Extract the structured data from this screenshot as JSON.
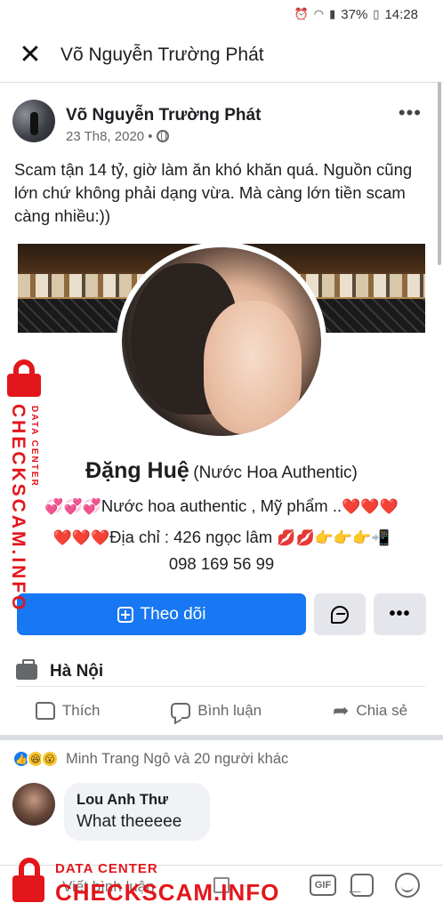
{
  "status_bar": {
    "battery": "37%",
    "time": "14:28"
  },
  "header": {
    "title": "Võ Nguyễn Trường Phát"
  },
  "post": {
    "author": "Võ Nguyễn Trường Phát",
    "date": "23 Th8, 2020 •",
    "text": "Scam tận 14 tỷ, giờ làm ăn khó khăn quá. Nguồn cũng lớn chứ không phải dạng vừa. Mà càng lớn tiền scam càng nhiều:))"
  },
  "shared_page": {
    "name": "Đặng Huệ",
    "category": "(Nước Hoa Authentic)",
    "bio_line1_emoji": "💞💞💞",
    "bio_line1_text": "Nước hoa authentic , Mỹ phẩm ..",
    "bio_line1_hearts": "❤️❤️❤️",
    "bio_line2_hearts": "❤️❤️❤️",
    "bio_line2_text": "Địa chỉ : 426 ngọc lâm ",
    "bio_line2_emoji": "💋💋👉👉👉📲",
    "phone": "098 169 56 99",
    "follow_label": "Theo dõi",
    "location": "Hà Nội"
  },
  "actions": {
    "like": "Thích",
    "comment": "Bình luận",
    "share": "Chia sẻ"
  },
  "reactions": {
    "summary": "Minh Trang Ngô và 20 người khác"
  },
  "comments": [
    {
      "author": "Lou Anh Thư",
      "text": "What theeeee"
    }
  ],
  "comment_input": {
    "placeholder": "Viết bình luận",
    "gif_label": "GIF"
  },
  "watermark": {
    "brand": "CHECKSCAM.INFO",
    "sub": "DATA CENTER",
    "color": "#e3161b"
  },
  "colors": {
    "accent": "#1877f2"
  }
}
